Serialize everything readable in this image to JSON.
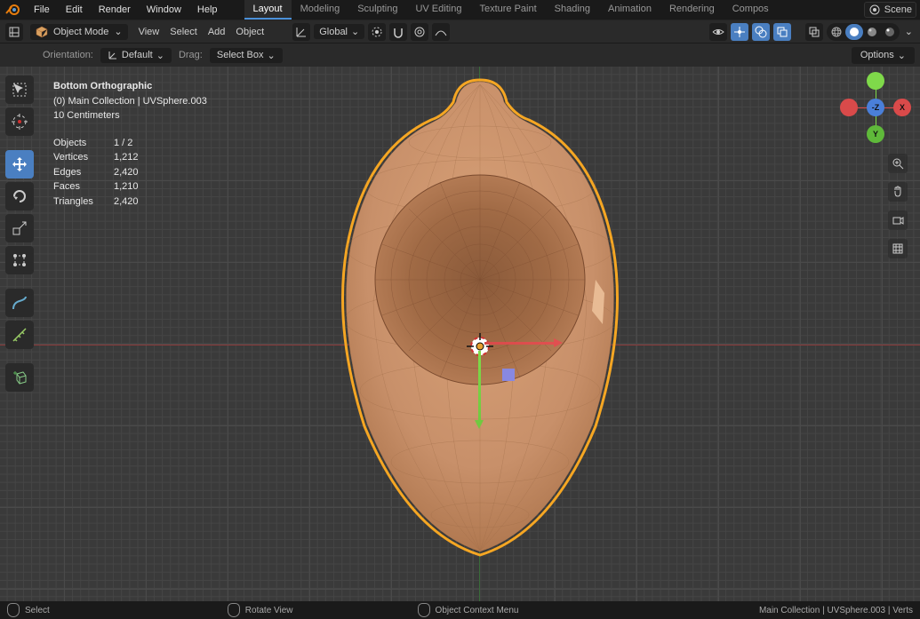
{
  "top_menu": {
    "items": [
      "File",
      "Edit",
      "Render",
      "Window",
      "Help"
    ]
  },
  "workspaces": {
    "tabs": [
      "Layout",
      "Modeling",
      "Sculpting",
      "UV Editing",
      "Texture Paint",
      "Shading",
      "Animation",
      "Rendering",
      "Compos"
    ],
    "active": 0
  },
  "scene": {
    "name": "Scene"
  },
  "mode": {
    "label": "Object Mode"
  },
  "header": {
    "view": "View",
    "select": "Select",
    "add": "Add",
    "object": "Object",
    "orientation": "Global"
  },
  "sub_header": {
    "orient_label": "Orientation:",
    "orient_value": "Default",
    "drag_label": "Drag:",
    "drag_value": "Select Box",
    "options": "Options"
  },
  "overlay": {
    "view_name": "Bottom Orthographic",
    "collection_line": "(0) Main Collection | UVSphere.003",
    "grid_scale": "10 Centimeters",
    "stats": {
      "objects_label": "Objects",
      "objects_val": "1 / 2",
      "vertices_label": "Vertices",
      "vertices_val": "1,212",
      "edges_label": "Edges",
      "edges_val": "2,420",
      "faces_label": "Faces",
      "faces_val": "1,210",
      "triangles_label": "Triangles",
      "triangles_val": "2,420"
    }
  },
  "gizmo": {
    "center": "-Z",
    "top": "",
    "bottom": "Y",
    "left": "",
    "right": "X"
  },
  "status": {
    "select": "Select",
    "rotate": "Rotate View",
    "context": "Object Context Menu",
    "path": "Main Collection | UVSphere.003 | Verts"
  },
  "colors": {
    "accent": "#4a7fc1",
    "axis_x": "#d94a4a",
    "axis_y": "#7fd94a"
  }
}
